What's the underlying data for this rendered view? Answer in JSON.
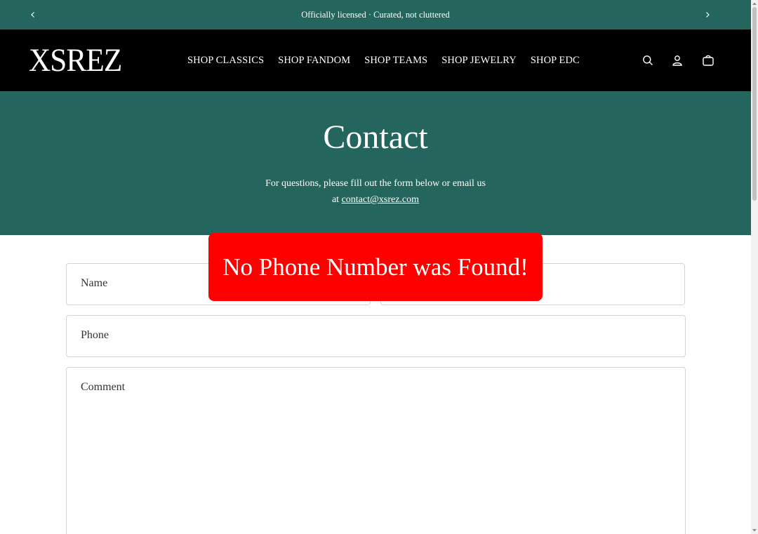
{
  "announcement": {
    "text": "Officially licensed · Curated, not cluttered",
    "prev_icon": "chevron-left-icon",
    "next_icon": "chevron-right-icon"
  },
  "header": {
    "logo": "XSREZ",
    "nav": [
      "SHOP CLASSICS",
      "SHOP FANDOM",
      "SHOP TEAMS",
      "SHOP JEWELRY",
      "SHOP EDC"
    ],
    "icons": [
      "search-icon",
      "account-icon",
      "cart-icon"
    ]
  },
  "hero": {
    "title": "Contact",
    "intro_line1": "For questions, please fill out the form below or email us",
    "intro_prefix": "at",
    "email": "contact@xsrez.com"
  },
  "form": {
    "name_placeholder": "Name",
    "phone_placeholder": "Phone",
    "comment_placeholder": "Comment"
  },
  "alert": {
    "message": "No Phone Number was Found!"
  },
  "colors": {
    "brand_green": "#24665d",
    "header_black": "#000000",
    "alert_red": "#ff0000"
  }
}
